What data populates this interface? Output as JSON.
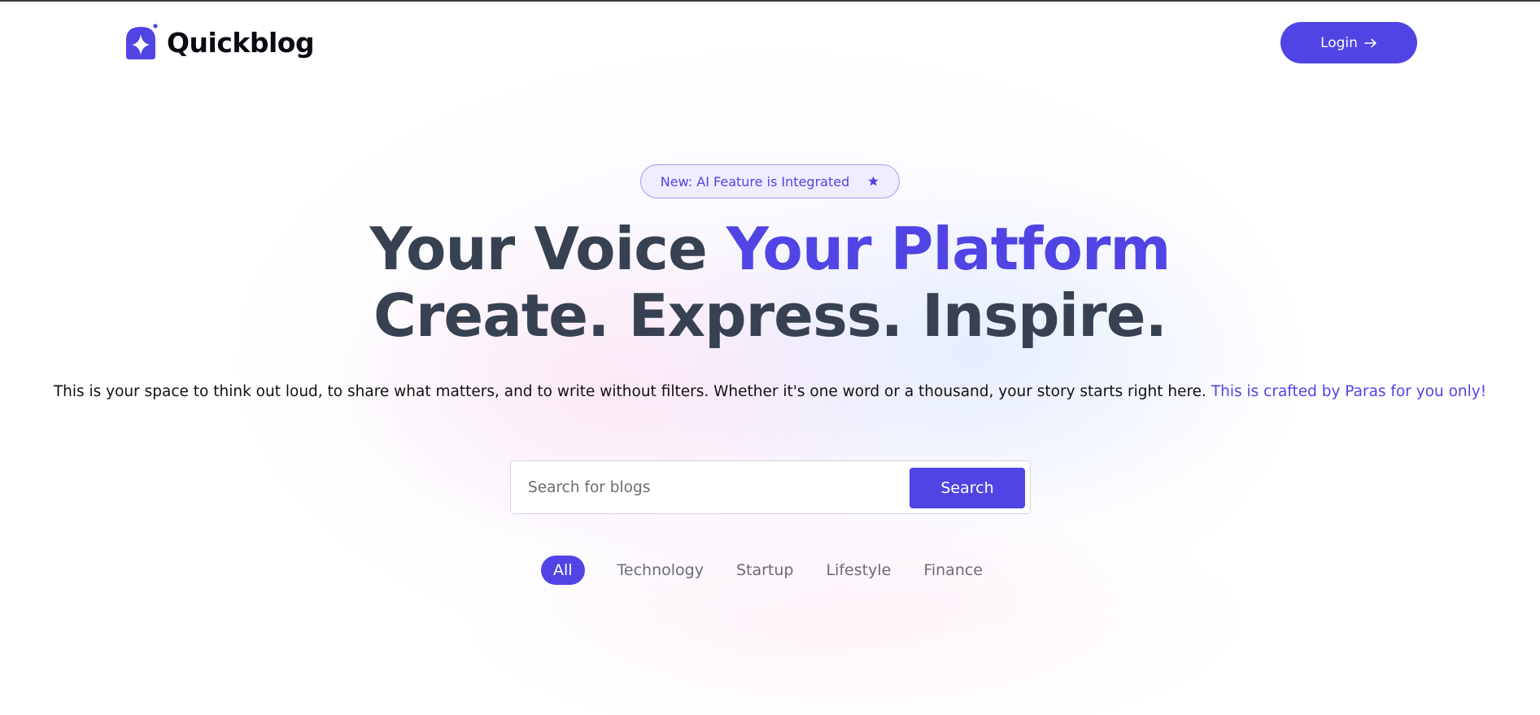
{
  "brand": {
    "name": "Quickblog",
    "logo_icon": "sparkle-house-icon",
    "accent_color": "#5044e5",
    "heading_color": "#374151"
  },
  "header": {
    "login_label": "Login",
    "login_icon": "arrow-right-icon"
  },
  "hero": {
    "badge_text": "New: AI Feature is Integrated",
    "badge_icon": "star-icon",
    "headline_plain": "Your Voice ",
    "headline_accent": "Your Platform",
    "headline_line2": "Create. Express. Inspire.",
    "description": "This is your space to think out loud, to share what matters, and to write without filters. Whether it's one word or a thousand, your story starts right here.",
    "description_accent": "This is crafted by Paras for you only!"
  },
  "search": {
    "placeholder": "Search for blogs",
    "value": "",
    "button_label": "Search"
  },
  "categories": {
    "items": [
      "All",
      "Technology",
      "Startup",
      "Lifestyle",
      "Finance"
    ],
    "selected": "All"
  }
}
